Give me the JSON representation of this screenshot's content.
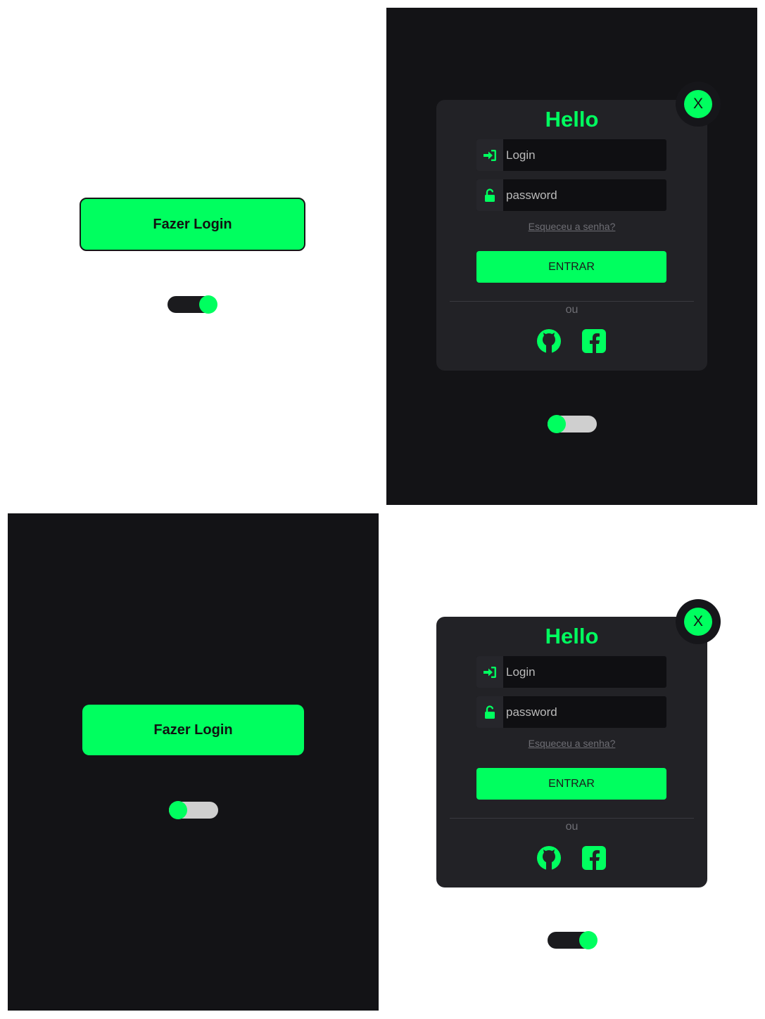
{
  "colors": {
    "accent": "#00ff5f",
    "dark_bg": "#131316",
    "card_bg": "#222226",
    "light_bg": "#ffffff"
  },
  "screens": [
    {
      "theme": "light",
      "login_button_label": "Fazer Login",
      "toggle_state": "on"
    },
    {
      "theme": "dark",
      "toggle_state": "off",
      "modal": {
        "close_label": "X",
        "title": "Hello",
        "login_placeholder": "Login",
        "password_placeholder": "password",
        "login_icon": "sign-in-icon",
        "password_icon": "unlock-icon",
        "forgot_link": "Esqueceu a senha?",
        "enter_label": "ENTRAR",
        "or_label": "ou",
        "social": [
          "github-icon",
          "facebook-icon"
        ]
      }
    },
    {
      "theme": "dark",
      "login_button_label": "Fazer Login",
      "toggle_state": "off"
    },
    {
      "theme": "light",
      "toggle_state": "on",
      "modal": {
        "close_label": "X",
        "title": "Hello",
        "login_placeholder": "Login",
        "password_placeholder": "password",
        "login_icon": "sign-in-icon",
        "password_icon": "unlock-icon",
        "forgot_link": "Esqueceu a senha?",
        "enter_label": "ENTRAR",
        "or_label": "ou",
        "social": [
          "github-icon",
          "facebook-icon"
        ]
      }
    }
  ]
}
